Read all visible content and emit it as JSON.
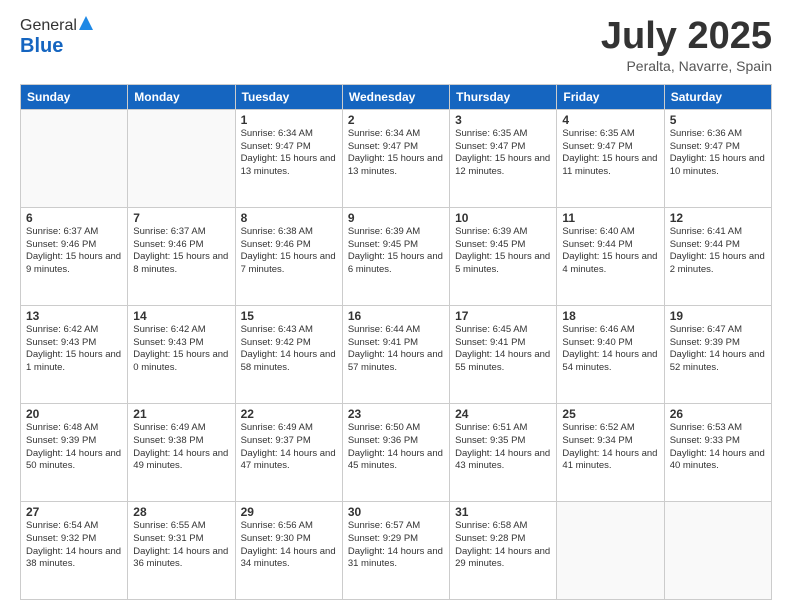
{
  "logo": {
    "general": "General",
    "blue": "Blue"
  },
  "header": {
    "month": "July 2025",
    "location": "Peralta, Navarre, Spain"
  },
  "weekdays": [
    "Sunday",
    "Monday",
    "Tuesday",
    "Wednesday",
    "Thursday",
    "Friday",
    "Saturday"
  ],
  "weeks": [
    [
      {
        "day": "",
        "info": ""
      },
      {
        "day": "",
        "info": ""
      },
      {
        "day": "1",
        "info": "Sunrise: 6:34 AM\nSunset: 9:47 PM\nDaylight: 15 hours and 13 minutes."
      },
      {
        "day": "2",
        "info": "Sunrise: 6:34 AM\nSunset: 9:47 PM\nDaylight: 15 hours and 13 minutes."
      },
      {
        "day": "3",
        "info": "Sunrise: 6:35 AM\nSunset: 9:47 PM\nDaylight: 15 hours and 12 minutes."
      },
      {
        "day": "4",
        "info": "Sunrise: 6:35 AM\nSunset: 9:47 PM\nDaylight: 15 hours and 11 minutes."
      },
      {
        "day": "5",
        "info": "Sunrise: 6:36 AM\nSunset: 9:47 PM\nDaylight: 15 hours and 10 minutes."
      }
    ],
    [
      {
        "day": "6",
        "info": "Sunrise: 6:37 AM\nSunset: 9:46 PM\nDaylight: 15 hours and 9 minutes."
      },
      {
        "day": "7",
        "info": "Sunrise: 6:37 AM\nSunset: 9:46 PM\nDaylight: 15 hours and 8 minutes."
      },
      {
        "day": "8",
        "info": "Sunrise: 6:38 AM\nSunset: 9:46 PM\nDaylight: 15 hours and 7 minutes."
      },
      {
        "day": "9",
        "info": "Sunrise: 6:39 AM\nSunset: 9:45 PM\nDaylight: 15 hours and 6 minutes."
      },
      {
        "day": "10",
        "info": "Sunrise: 6:39 AM\nSunset: 9:45 PM\nDaylight: 15 hours and 5 minutes."
      },
      {
        "day": "11",
        "info": "Sunrise: 6:40 AM\nSunset: 9:44 PM\nDaylight: 15 hours and 4 minutes."
      },
      {
        "day": "12",
        "info": "Sunrise: 6:41 AM\nSunset: 9:44 PM\nDaylight: 15 hours and 2 minutes."
      }
    ],
    [
      {
        "day": "13",
        "info": "Sunrise: 6:42 AM\nSunset: 9:43 PM\nDaylight: 15 hours and 1 minute."
      },
      {
        "day": "14",
        "info": "Sunrise: 6:42 AM\nSunset: 9:43 PM\nDaylight: 15 hours and 0 minutes."
      },
      {
        "day": "15",
        "info": "Sunrise: 6:43 AM\nSunset: 9:42 PM\nDaylight: 14 hours and 58 minutes."
      },
      {
        "day": "16",
        "info": "Sunrise: 6:44 AM\nSunset: 9:41 PM\nDaylight: 14 hours and 57 minutes."
      },
      {
        "day": "17",
        "info": "Sunrise: 6:45 AM\nSunset: 9:41 PM\nDaylight: 14 hours and 55 minutes."
      },
      {
        "day": "18",
        "info": "Sunrise: 6:46 AM\nSunset: 9:40 PM\nDaylight: 14 hours and 54 minutes."
      },
      {
        "day": "19",
        "info": "Sunrise: 6:47 AM\nSunset: 9:39 PM\nDaylight: 14 hours and 52 minutes."
      }
    ],
    [
      {
        "day": "20",
        "info": "Sunrise: 6:48 AM\nSunset: 9:39 PM\nDaylight: 14 hours and 50 minutes."
      },
      {
        "day": "21",
        "info": "Sunrise: 6:49 AM\nSunset: 9:38 PM\nDaylight: 14 hours and 49 minutes."
      },
      {
        "day": "22",
        "info": "Sunrise: 6:49 AM\nSunset: 9:37 PM\nDaylight: 14 hours and 47 minutes."
      },
      {
        "day": "23",
        "info": "Sunrise: 6:50 AM\nSunset: 9:36 PM\nDaylight: 14 hours and 45 minutes."
      },
      {
        "day": "24",
        "info": "Sunrise: 6:51 AM\nSunset: 9:35 PM\nDaylight: 14 hours and 43 minutes."
      },
      {
        "day": "25",
        "info": "Sunrise: 6:52 AM\nSunset: 9:34 PM\nDaylight: 14 hours and 41 minutes."
      },
      {
        "day": "26",
        "info": "Sunrise: 6:53 AM\nSunset: 9:33 PM\nDaylight: 14 hours and 40 minutes."
      }
    ],
    [
      {
        "day": "27",
        "info": "Sunrise: 6:54 AM\nSunset: 9:32 PM\nDaylight: 14 hours and 38 minutes."
      },
      {
        "day": "28",
        "info": "Sunrise: 6:55 AM\nSunset: 9:31 PM\nDaylight: 14 hours and 36 minutes."
      },
      {
        "day": "29",
        "info": "Sunrise: 6:56 AM\nSunset: 9:30 PM\nDaylight: 14 hours and 34 minutes."
      },
      {
        "day": "30",
        "info": "Sunrise: 6:57 AM\nSunset: 9:29 PM\nDaylight: 14 hours and 31 minutes."
      },
      {
        "day": "31",
        "info": "Sunrise: 6:58 AM\nSunset: 9:28 PM\nDaylight: 14 hours and 29 minutes."
      },
      {
        "day": "",
        "info": ""
      },
      {
        "day": "",
        "info": ""
      }
    ]
  ]
}
